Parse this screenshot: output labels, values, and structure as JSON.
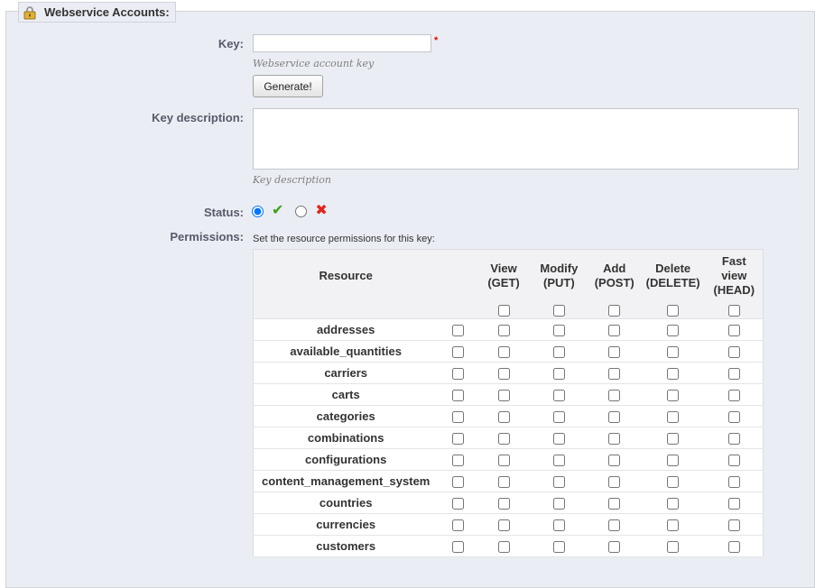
{
  "legend": {
    "title": "Webservice Accounts:"
  },
  "key": {
    "label": "Key:",
    "value": "",
    "required_mark": "*",
    "hint": "Webservice account key",
    "generate_label": "Generate!"
  },
  "description": {
    "label": "Key description:",
    "value": "",
    "hint": "Key description"
  },
  "status": {
    "label": "Status:",
    "enabled_selected": true
  },
  "permissions": {
    "label": "Permissions:",
    "hint": "Set the resource permissions for this key:",
    "headers": {
      "resource": "Resource",
      "view": [
        "View",
        "(GET)"
      ],
      "modify": [
        "Modify",
        "(PUT)"
      ],
      "add": [
        "Add",
        "(POST)"
      ],
      "delete": [
        "Delete",
        "(DELETE)"
      ],
      "fast": [
        "Fast",
        "view",
        "(HEAD)"
      ]
    },
    "resources": [
      "addresses",
      "available_quantities",
      "carriers",
      "carts",
      "categories",
      "combinations",
      "configurations",
      "content_management_system",
      "countries",
      "currencies",
      "customers"
    ]
  },
  "colors": {
    "accent_ok": "#3aa01a",
    "accent_no": "#e3241b",
    "background": "#ebedf4"
  }
}
